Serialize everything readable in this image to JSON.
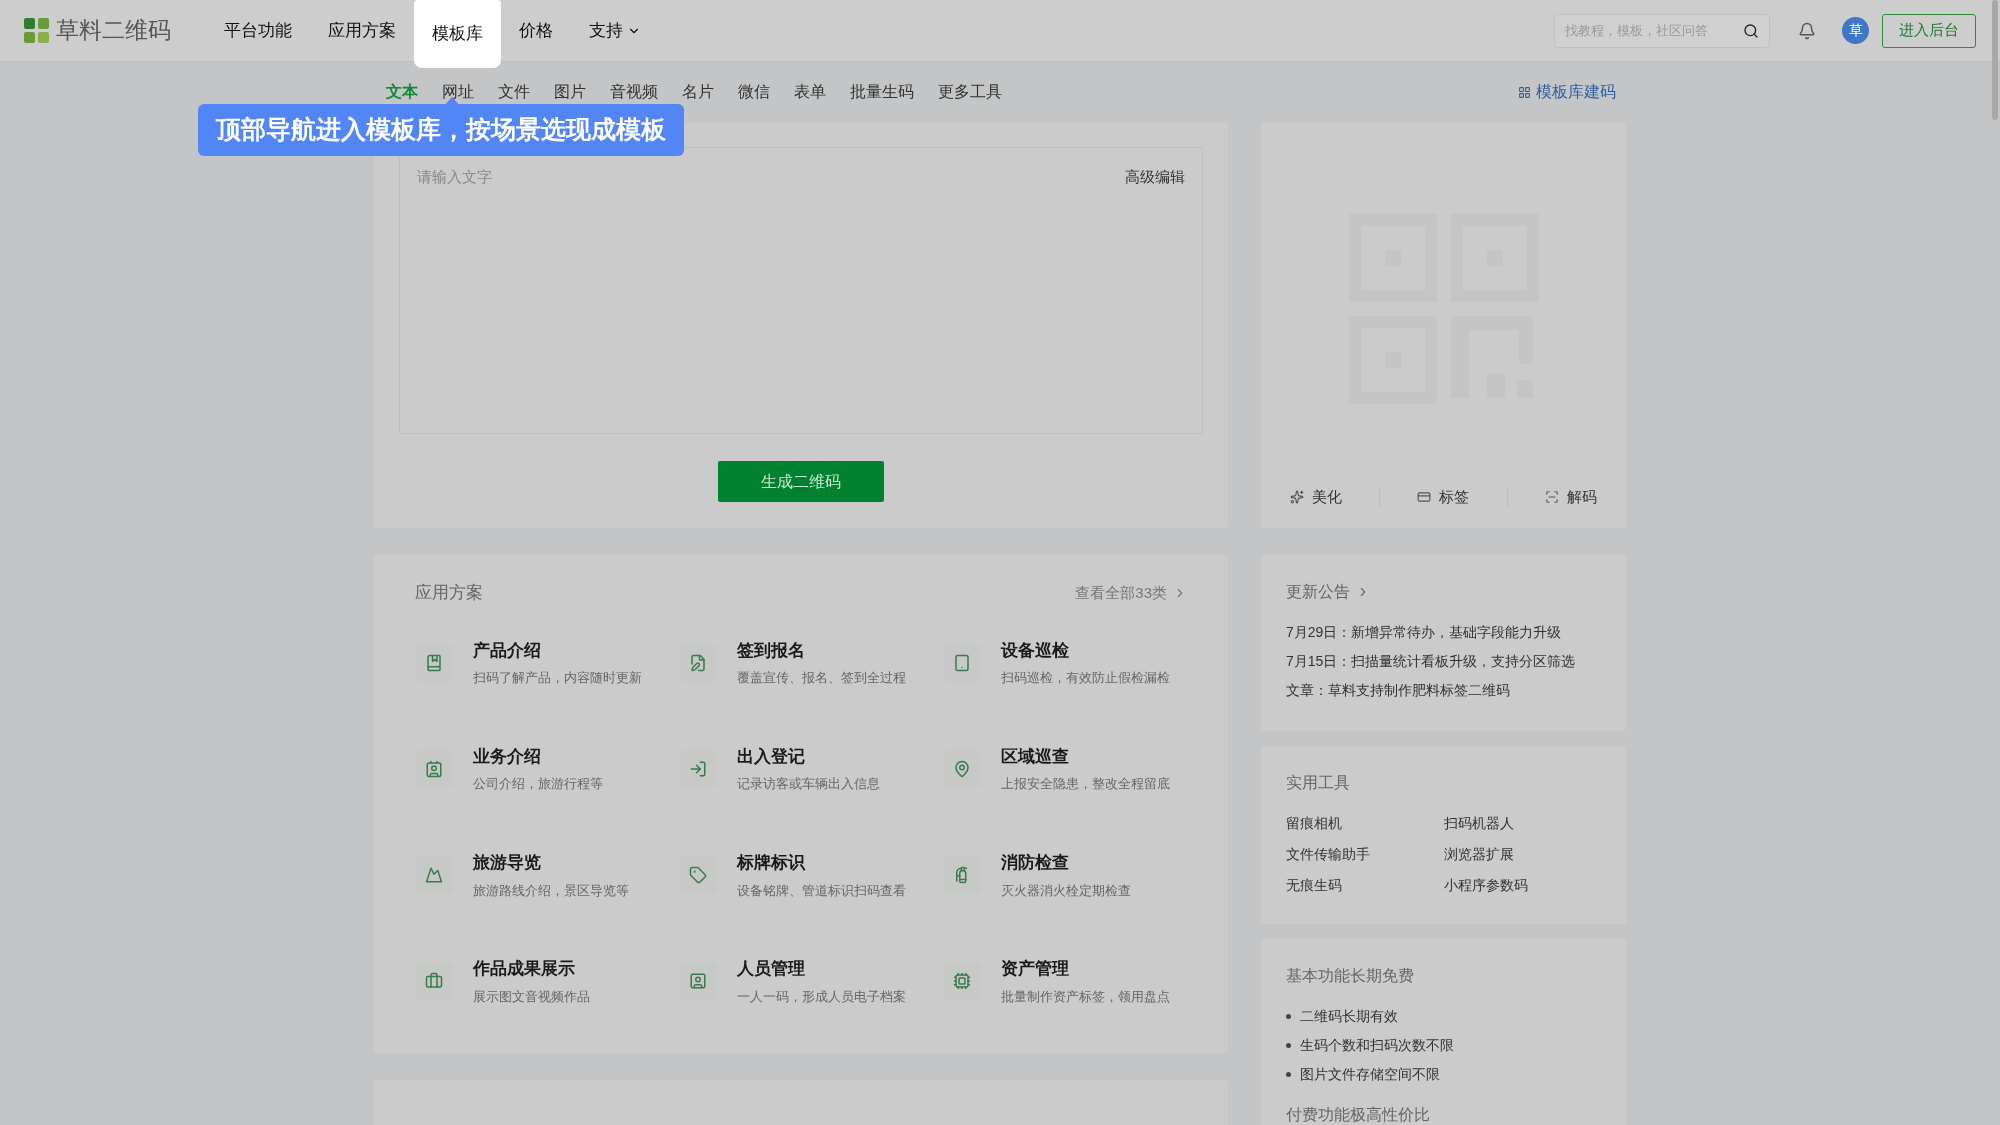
{
  "header": {
    "logo": "草料二维码",
    "nav": [
      {
        "label": "平台功能",
        "kind": "link",
        "selected": false
      },
      {
        "label": "应用方案",
        "kind": "link",
        "selected": false
      },
      {
        "label": "模板库",
        "kind": "link",
        "selected": true
      },
      {
        "label": "价格",
        "kind": "link",
        "selected": false
      },
      {
        "label": "支持",
        "kind": "dropdown",
        "selected": false
      }
    ],
    "search": {
      "placeholder": "找教程，模板，社区问答"
    },
    "avatar": "草",
    "console_button": "进入后台"
  },
  "callout": "顶部导航进入模板库，按场景选现成模板",
  "tabs": [
    {
      "label": "文本",
      "selected": true
    },
    {
      "label": "网址",
      "selected": false
    },
    {
      "label": "文件",
      "selected": false
    },
    {
      "label": "图片",
      "selected": false
    },
    {
      "label": "音视频",
      "selected": false
    },
    {
      "label": "名片",
      "selected": false
    },
    {
      "label": "微信",
      "selected": false
    },
    {
      "label": "表单",
      "selected": false
    },
    {
      "label": "批量生码",
      "selected": false
    },
    {
      "label": "更多工具",
      "selected": false
    }
  ],
  "template_link": "模板库建码",
  "editor": {
    "placeholder": "请输入文字",
    "advanced": "高级编辑",
    "generate": "生成二维码"
  },
  "preview_actions": [
    "美化",
    "标签",
    "解码"
  ],
  "solutions": {
    "title": "应用方案",
    "more": "查看全部33类",
    "items": [
      {
        "title": "产品介绍",
        "desc": "扫码了解产品，内容随时更新"
      },
      {
        "title": "签到报名",
        "desc": "覆盖宣传、报名、签到全过程"
      },
      {
        "title": "设备巡检",
        "desc": "扫码巡检，有效防止假检漏检"
      },
      {
        "title": "业务介绍",
        "desc": "公司介绍，旅游行程等"
      },
      {
        "title": "出入登记",
        "desc": "记录访客或车辆出入信息"
      },
      {
        "title": "区域巡查",
        "desc": "上报安全隐患，整改全程留底"
      },
      {
        "title": "旅游导览",
        "desc": "旅游路线介绍，景区导览等"
      },
      {
        "title": "标牌标识",
        "desc": "设备铭牌、管道标识扫码查看"
      },
      {
        "title": "消防检查",
        "desc": "灭火器消火栓定期检查"
      },
      {
        "title": "作品成果展示",
        "desc": "展示图文音视频作品"
      },
      {
        "title": "人员管理",
        "desc": "一人一码，形成人员电子档案"
      },
      {
        "title": "资产管理",
        "desc": "批量制作资产标签，领用盘点"
      }
    ]
  },
  "news": {
    "title": "更新公告",
    "items": [
      "7月29日：新增异常待办，基础字段能力升级",
      "7月15日：扫描量统计看板升级，支持分区筛选",
      "文章：草料支持制作肥料标签二维码"
    ]
  },
  "tools": {
    "title": "实用工具",
    "items": [
      "留痕相机",
      "扫码机器人",
      "文件传输助手",
      "浏览器扩展",
      "无痕生码",
      "小程序参数码"
    ]
  },
  "free": {
    "title": "基本功能长期免费",
    "items": [
      "二维码长期有效",
      "生码个数和扫码次数不限",
      "图片文件存储空间不限"
    ],
    "footer": "付费功能极高性价比"
  }
}
